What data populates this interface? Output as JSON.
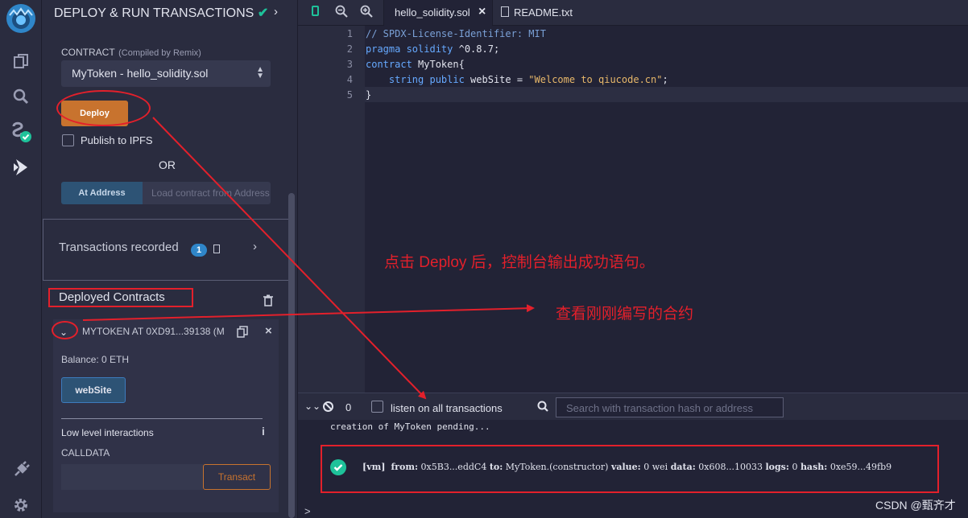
{
  "panel": {
    "title": "DEPLOY & RUN TRANSACTIONS",
    "contract_label": "CONTRACT",
    "contract_hint": "(Compiled by Remix)",
    "contract_selected": "MyToken - hello_solidity.sol",
    "deploy_label": "Deploy",
    "publish_label": "Publish to IPFS",
    "or_label": "OR",
    "at_address_label": "At Address",
    "at_address_placeholder": "Load contract from Address",
    "transactions_recorded_label": "Transactions recorded",
    "transactions_recorded_count": "1",
    "deployed_contracts_label": "Deployed Contracts",
    "instance": {
      "title": "MYTOKEN AT 0XD91...39138 (M",
      "balance": "Balance: 0 ETH",
      "website_button": "webSite",
      "low_level_label": "Low level interactions",
      "calldata_label": "CALLDATA",
      "transact_label": "Transact"
    }
  },
  "editor": {
    "tabs": [
      {
        "label": "hello_solidity.sol",
        "active": true
      },
      {
        "label": "README.txt",
        "active": false
      }
    ],
    "lines": [
      {
        "num": "1",
        "tokens": [
          {
            "t": "// SPDX-License-Identifier: MIT",
            "c": "#7aa0d6"
          }
        ]
      },
      {
        "num": "2",
        "tokens": [
          {
            "t": "pragma solidity ",
            "c": "#66a9ff"
          },
          {
            "t": "^0.8.7;",
            "c": "#e1e3ed"
          }
        ]
      },
      {
        "num": "3",
        "tokens": [
          {
            "t": "contract ",
            "c": "#66a9ff"
          },
          {
            "t": "MyToken{",
            "c": "#e1e3ed"
          }
        ]
      },
      {
        "num": "4",
        "tokens": [
          {
            "t": "    string public ",
            "c": "#66a9ff"
          },
          {
            "t": "webSite = ",
            "c": "#e1e3ed"
          },
          {
            "t": "\"Welcome to qiucode.cn\"",
            "c": "#e8b86a"
          },
          {
            "t": ";",
            "c": "#e1e3ed"
          }
        ]
      },
      {
        "num": "5",
        "tokens": [
          {
            "t": "}",
            "c": "#e1e3ed"
          }
        ]
      }
    ]
  },
  "annotations": {
    "note1": "点击 Deploy 后，控制台输出成功语句。",
    "note2": "查看刚刚编写的合约",
    "color": "#e3202b"
  },
  "terminal": {
    "count": "0",
    "listen_label": "listen on all transactions",
    "search_placeholder": "Search with transaction hash or address",
    "pending": "creation of MyToken pending...",
    "log": {
      "vm": "[vm]",
      "from_k": "from:",
      "from_v": "0x5B3...eddC4",
      "to_k": "to:",
      "to_v": "MyToken.(constructor)",
      "value_k": "value:",
      "value_v": "0 wei",
      "data_k": "data:",
      "data_v": "0x608...10033",
      "logs_k": "logs:",
      "logs_v": "0",
      "hash_k": "hash:",
      "hash_v": "0xe59...49fb9"
    },
    "prompt": ">"
  },
  "watermark": "CSDN @甄齐才",
  "colors": {
    "accent_green": "#1ec29a",
    "deploy_orange": "#c8732e",
    "link_blue": "#3d7bbd"
  }
}
